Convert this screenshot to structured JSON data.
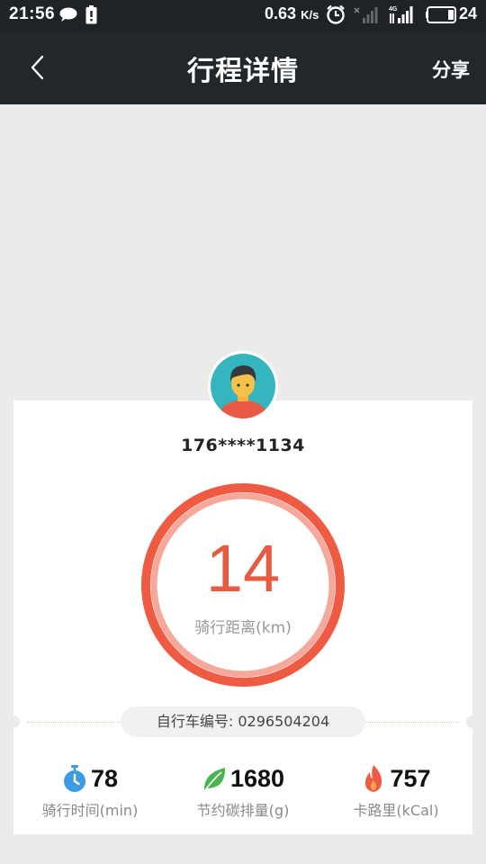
{
  "status_bar": {
    "time": "21:56",
    "net_speed": "0.63",
    "net_unit": "K/s",
    "battery": "24"
  },
  "nav": {
    "title": "行程详情",
    "share_label": "分享"
  },
  "user": {
    "phone": "176****1134"
  },
  "distance": {
    "value": "14",
    "label": "骑行距离(km)"
  },
  "bike": {
    "label": "自行车编号: 0296504204"
  },
  "stats": [
    {
      "icon": "stopwatch-icon",
      "value": "78",
      "label": "骑行时间(min)"
    },
    {
      "icon": "leaf-icon",
      "value": "1680",
      "label": "节约碳排量(g)"
    },
    {
      "icon": "flame-icon",
      "value": "757",
      "label": "卡路里(kCal)"
    }
  ],
  "colors": {
    "accent": "#e75b42",
    "header": "#22272b",
    "background": "#ebebeb"
  }
}
